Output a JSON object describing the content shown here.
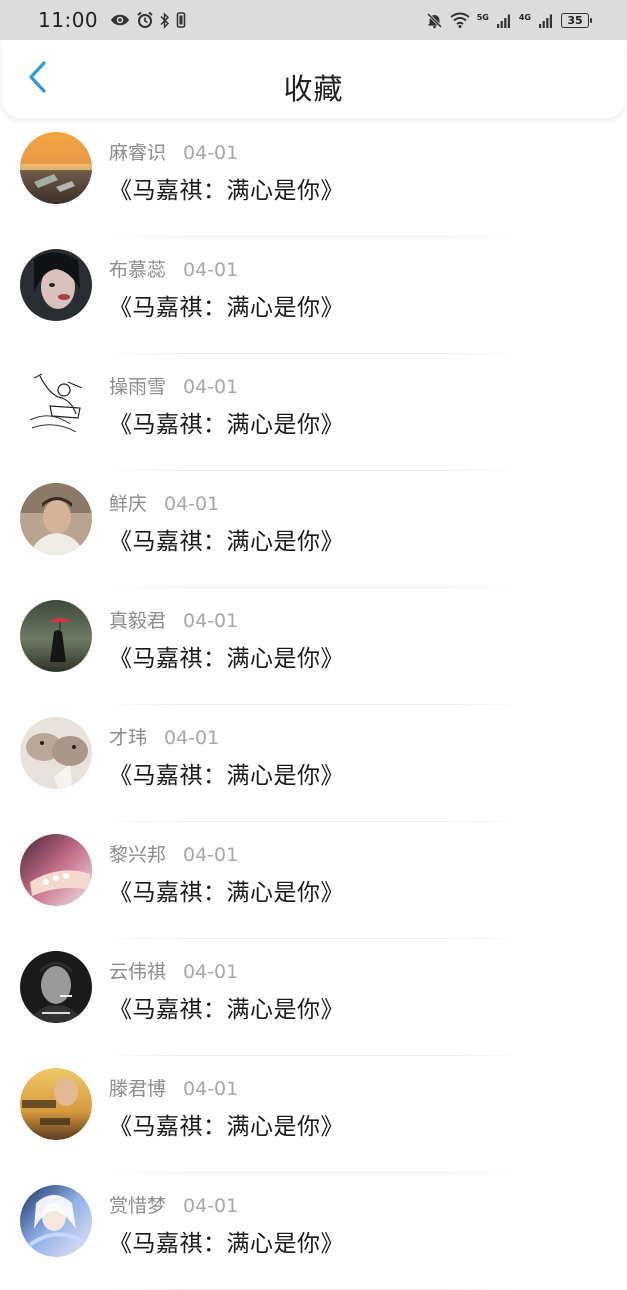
{
  "status_bar": {
    "time": "11:00",
    "net1": "5G",
    "net2": "4G",
    "battery": "35"
  },
  "header": {
    "title": "收藏"
  },
  "favorites": [
    {
      "name": "麻睿识",
      "date": "04-01",
      "song": "《马嘉祺：满心是你》"
    },
    {
      "name": "布慕蕊",
      "date": "04-01",
      "song": "《马嘉祺：满心是你》"
    },
    {
      "name": "操雨雪",
      "date": "04-01",
      "song": "《马嘉祺：满心是你》"
    },
    {
      "name": "鲜庆",
      "date": "04-01",
      "song": "《马嘉祺：满心是你》"
    },
    {
      "name": "真毅君",
      "date": "04-01",
      "song": "《马嘉祺：满心是你》"
    },
    {
      "name": "才玮",
      "date": "04-01",
      "song": "《马嘉祺：满心是你》"
    },
    {
      "name": "黎兴邦",
      "date": "04-01",
      "song": "《马嘉祺：满心是你》"
    },
    {
      "name": "云伟祺",
      "date": "04-01",
      "song": "《马嘉祺：满心是你》"
    },
    {
      "name": "滕君博",
      "date": "04-01",
      "song": "《马嘉祺：满心是你》"
    },
    {
      "name": "赏惜梦",
      "date": "04-01",
      "song": "《马嘉祺：满心是你》"
    }
  ],
  "colors": {
    "accent": "#2f9ad8",
    "status_bar_bg": "#dcdcdc",
    "name_text": "#8c8c8c",
    "title_text": "#222222"
  }
}
